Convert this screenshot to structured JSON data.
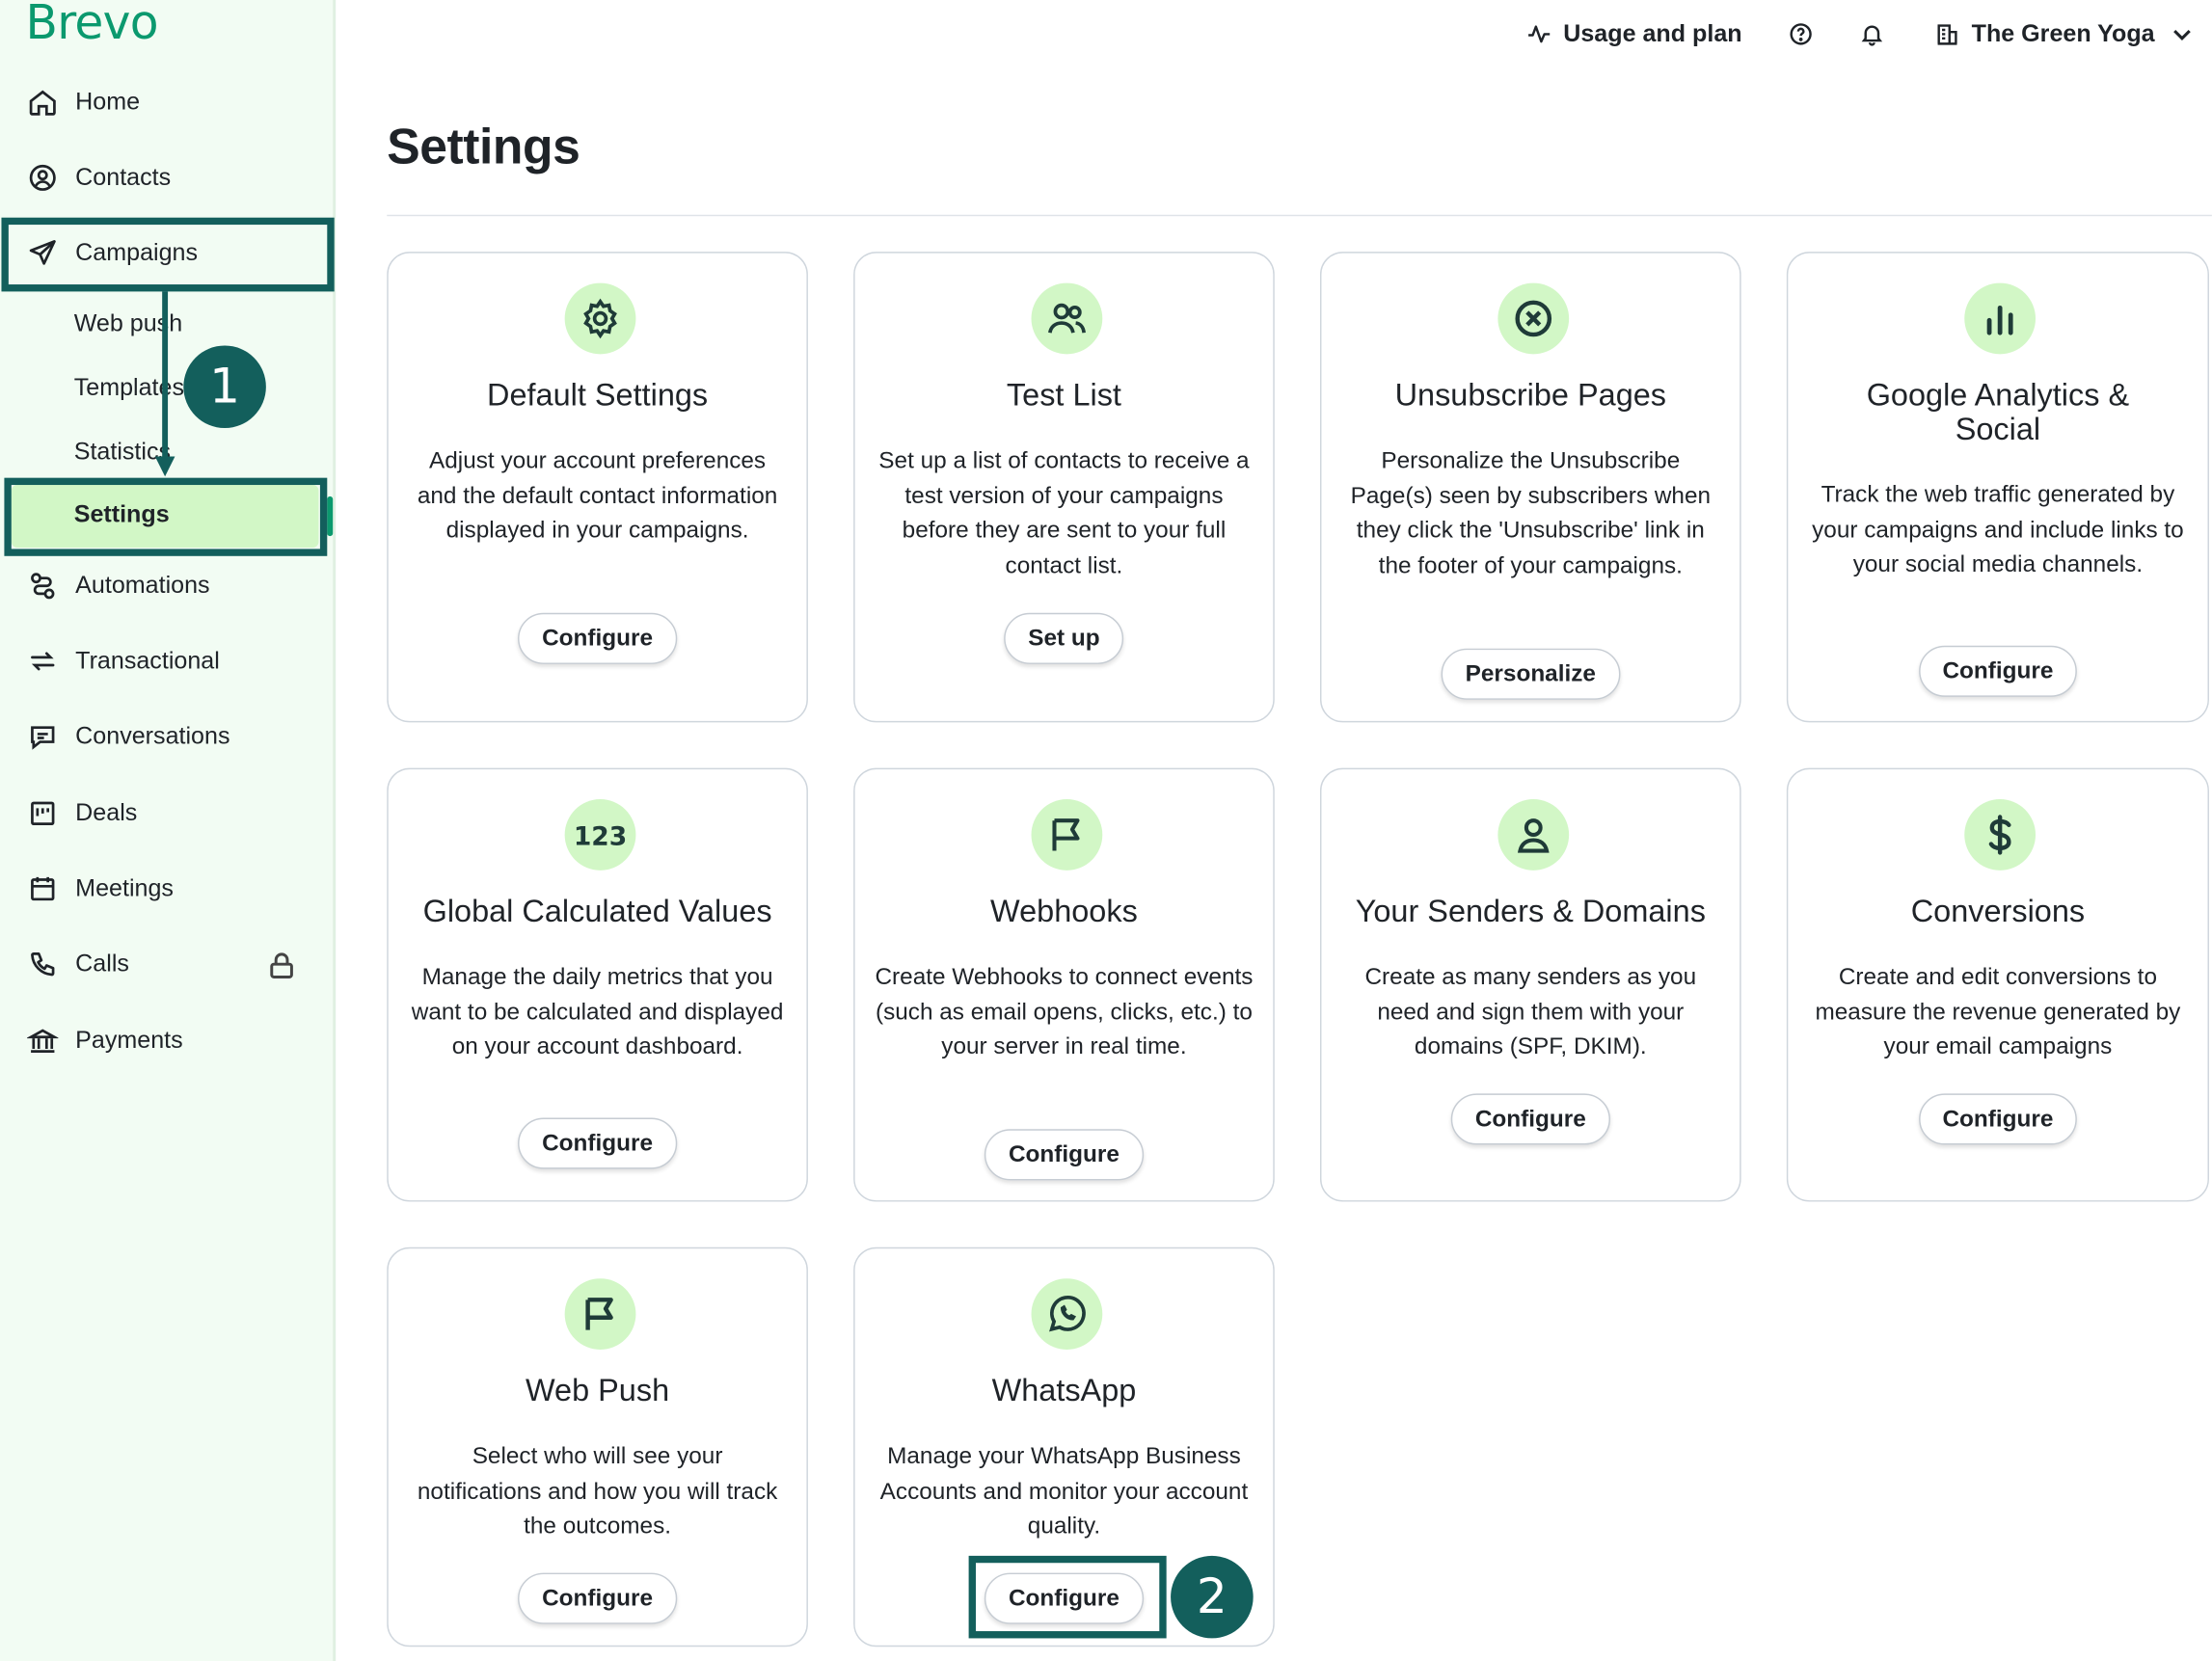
{
  "app": {
    "logo": "Brevo"
  },
  "sidebar": {
    "items": [
      {
        "label": "Home"
      },
      {
        "label": "Contacts"
      },
      {
        "label": "Campaigns"
      },
      {
        "label": "Automations"
      },
      {
        "label": "Transactional"
      },
      {
        "label": "Conversations"
      },
      {
        "label": "Deals"
      },
      {
        "label": "Meetings"
      },
      {
        "label": "Calls"
      },
      {
        "label": "Payments"
      }
    ],
    "sub_items": [
      {
        "label": "Web push"
      },
      {
        "label": "Templates"
      },
      {
        "label": "Statistics"
      },
      {
        "label": "Settings"
      }
    ]
  },
  "header": {
    "usage_label": "Usage and plan",
    "account_label": "The Green Yoga"
  },
  "page": {
    "title": "Settings"
  },
  "cards": [
    {
      "title": "Default Settings",
      "desc": "Adjust your account preferences and the default contact information displayed in your campaigns.",
      "button": "Configure",
      "icon": "gear-icon"
    },
    {
      "title": "Test List",
      "desc": "Set up a list of contacts to receive a test version of your campaigns before they are sent to your full contact list.",
      "button": "Set up",
      "icon": "users-icon"
    },
    {
      "title": "Unsubscribe Pages",
      "desc": "Personalize the Unsubscribe Page(s) seen by subscribers when they click the 'Unsubscribe' link in the footer of your campaigns.",
      "button": "Personalize",
      "icon": "x-circle-icon"
    },
    {
      "title": "Google Analytics & Social",
      "desc": "Track the web traffic generated by your campaigns and include links to your social media channels.",
      "button": "Configure",
      "icon": "bar-chart-icon"
    },
    {
      "title": "Global Calculated Values",
      "desc": "Manage the daily metrics that you want to be calculated and displayed on your account dashboard.",
      "button": "Configure",
      "icon": "numbers-icon"
    },
    {
      "title": "Webhooks",
      "desc": "Create Webhooks to connect events (such as email opens, clicks, etc.) to your server in real time.",
      "button": "Configure",
      "icon": "flag-icon"
    },
    {
      "title": "Your Senders & Domains",
      "desc": "Create as many senders as you need and sign them with your domains (SPF, DKIM).",
      "button": "Configure",
      "icon": "user-icon"
    },
    {
      "title": "Conversions",
      "desc": "Create and edit conversions to measure the revenue generated by your email campaigns",
      "button": "Configure",
      "icon": "dollar-icon"
    },
    {
      "title": "Web Push",
      "desc": "Select who will see your notifications and how you will track the outcomes.",
      "button": "Configure",
      "icon": "flag-icon"
    },
    {
      "title": "WhatsApp",
      "desc": "Manage your WhatsApp Business Accounts and monitor your account quality.",
      "button": "Configure",
      "icon": "whatsapp-icon"
    }
  ],
  "annotations": [
    {
      "label": "1"
    },
    {
      "label": "2"
    }
  ]
}
